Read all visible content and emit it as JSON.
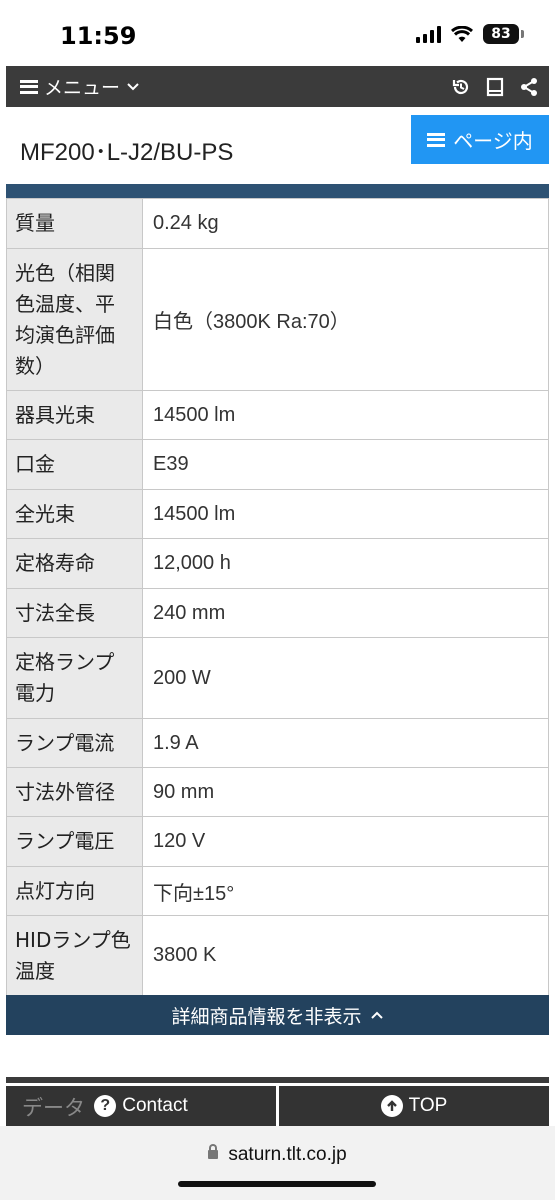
{
  "status": {
    "time": "11:59",
    "battery": "83"
  },
  "menubar": {
    "menu_label": "メニュー"
  },
  "header": {
    "title": "MF200･L-J2/BU-PS",
    "page_nav_label": "ページ内"
  },
  "specs": [
    {
      "label": "質量",
      "value": "0.24 kg"
    },
    {
      "label": "光色（相関色温度、平均演色評価数）",
      "value": "白色（3800K Ra:70）"
    },
    {
      "label": "器具光束",
      "value": "14500 lm"
    },
    {
      "label": "口金",
      "value": "E39"
    },
    {
      "label": "全光束",
      "value": "14500 lm"
    },
    {
      "label": "定格寿命",
      "value": "12,000 h"
    },
    {
      "label": "寸法全長",
      "value": "240 mm"
    },
    {
      "label": "定格ランプ電力",
      "value": "200 W"
    },
    {
      "label": "ランプ電流",
      "value": "1.9 A"
    },
    {
      "label": "寸法外管径",
      "value": "90 mm"
    },
    {
      "label": "ランプ電圧",
      "value": "120 V"
    },
    {
      "label": "点灯方向",
      "value": "下向±15°"
    },
    {
      "label": "HIDランプ色温度",
      "value": "3800 K"
    }
  ],
  "toggle": {
    "label": "詳細商品情報を非表示"
  },
  "footer": {
    "ghost_text": "データ",
    "contact_label": "Contact",
    "top_label": "TOP"
  },
  "browser": {
    "url": "saturn.tlt.co.jp"
  }
}
